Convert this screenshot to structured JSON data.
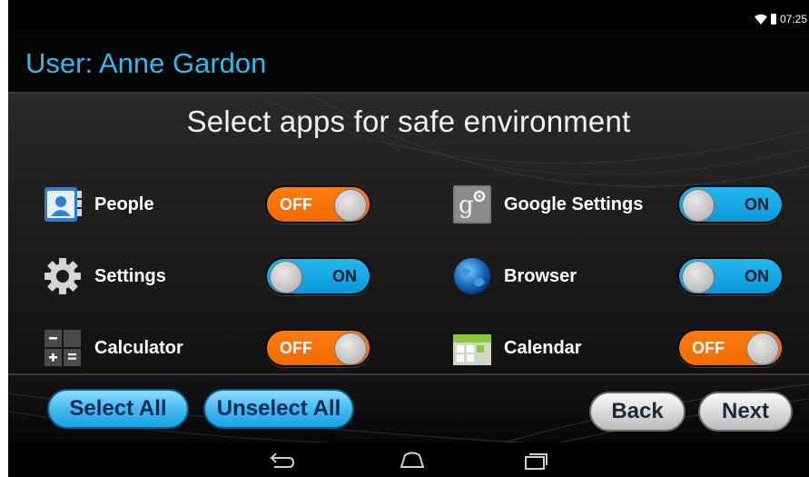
{
  "status_bar": {
    "time": "07:25"
  },
  "header": {
    "user_title": "User: Anne Gardon"
  },
  "panel": {
    "title": "Select apps for safe environment"
  },
  "apps": [
    {
      "name": "People",
      "state": "OFF",
      "icon": "people-icon"
    },
    {
      "name": "Google Settings",
      "state": "ON",
      "icon": "google-settings-icon"
    },
    {
      "name": "Settings",
      "state": "ON",
      "icon": "gear-icon"
    },
    {
      "name": "Browser",
      "state": "ON",
      "icon": "globe-icon"
    },
    {
      "name": "Calculator",
      "state": "OFF",
      "icon": "calculator-icon"
    },
    {
      "name": "Calendar",
      "state": "OFF",
      "icon": "calendar-icon"
    }
  ],
  "buttons": {
    "select_all": "Select All",
    "unselect_all": "Unselect All",
    "back": "Back",
    "next": "Next"
  },
  "colors": {
    "accent_blue": "#39b6ea",
    "toggle_off": "#f06a00",
    "toggle_on": "#1aa8e8"
  },
  "nav": {
    "icons": [
      "back-icon",
      "home-icon",
      "recents-icon"
    ]
  }
}
